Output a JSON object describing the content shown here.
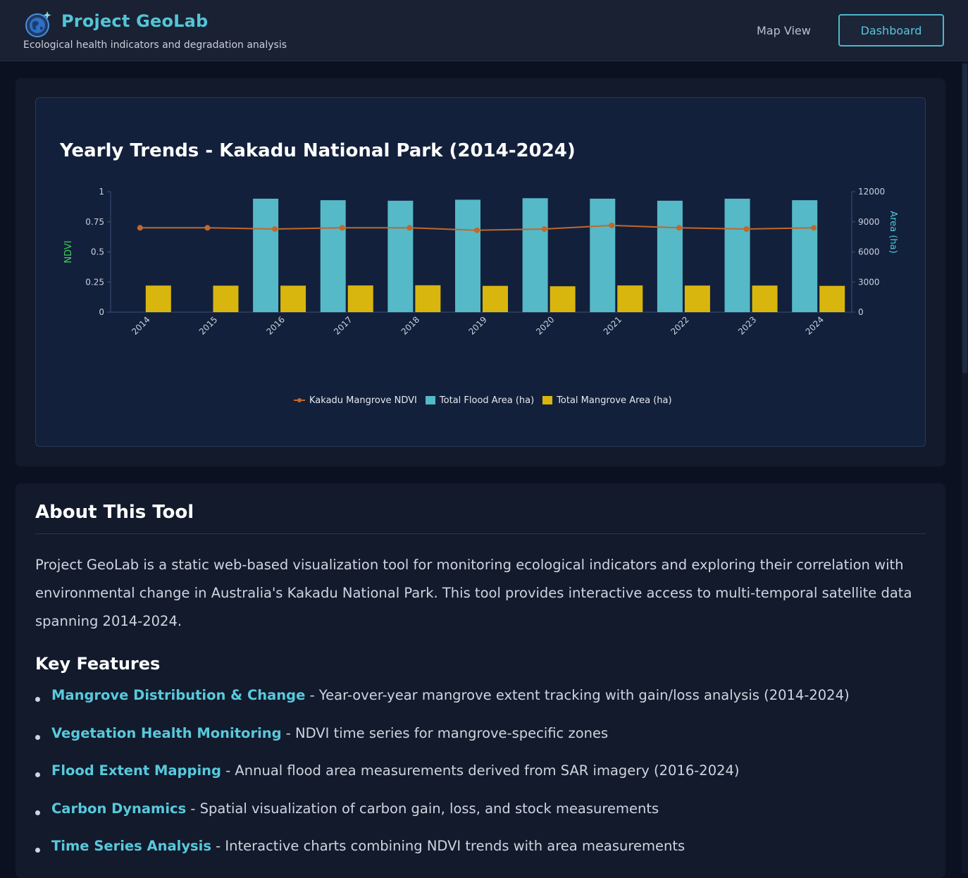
{
  "header": {
    "title": "Project GeoLab",
    "subtitle": "Ecological health indicators and degradation analysis",
    "nav_map_view": "Map View",
    "nav_dashboard": "Dashboard"
  },
  "colors": {
    "accent": "#52c5d8",
    "ndvi_line": "#c2672b",
    "flood_bar": "#55b9c7",
    "mangrove_bar": "#d8b60e"
  },
  "chart_title": "Yearly Trends - Kakadu National Park (2014-2024)",
  "legend": {
    "ndvi": "Kakadu Mangrove NDVI",
    "flood": "Total Flood Area (ha)",
    "mangrove": "Total Mangrove Area (ha)"
  },
  "chart_data": {
    "type": "bar",
    "title": "Yearly Trends - Kakadu National Park (2014-2024)",
    "categories": [
      "2014",
      "2015",
      "2016",
      "2017",
      "2018",
      "2019",
      "2020",
      "2021",
      "2022",
      "2023",
      "2024"
    ],
    "y_left": {
      "label": "NDVI",
      "range": [
        0,
        1
      ],
      "ticks": [
        "0",
        "0.25",
        "0.5",
        "0.75",
        "1"
      ]
    },
    "y_right": {
      "label": "Area (ha)",
      "range": [
        0,
        12000
      ],
      "ticks": [
        "0",
        "3000",
        "6000",
        "9000",
        "12000"
      ]
    },
    "series": [
      {
        "name": "Kakadu Mangrove NDVI",
        "kind": "line",
        "axis": "left",
        "values": [
          0.7,
          0.7,
          0.69,
          0.7,
          0.7,
          0.68,
          0.69,
          0.72,
          0.7,
          0.69,
          0.7
        ]
      },
      {
        "name": "Total Flood Area (ha)",
        "kind": "bar",
        "axis": "right",
        "values": [
          null,
          null,
          11300,
          11150,
          11100,
          11200,
          11350,
          11300,
          11100,
          11300,
          11150
        ]
      },
      {
        "name": "Total Mangrove Area (ha)",
        "kind": "bar",
        "axis": "right",
        "values": [
          2650,
          2640,
          2640,
          2660,
          2680,
          2620,
          2580,
          2660,
          2650,
          2650,
          2620
        ]
      }
    ],
    "legend_position": "bottom-center",
    "grid": false
  },
  "about": {
    "title": "About This Tool",
    "paragraph": "Project GeoLab is a static web-based visualization tool for monitoring ecological indicators and exploring their correlation with environmental change in Australia's Kakadu National Park. This tool provides interactive access to multi-temporal satellite data spanning 2014-2024.",
    "features_title": "Key Features",
    "features": [
      {
        "name": "Mangrove Distribution & Change",
        "desc": " - Year-over-year mangrove extent tracking with gain/loss analysis (2014-2024)"
      },
      {
        "name": "Vegetation Health Monitoring",
        "desc": " - NDVI time series for mangrove-specific zones"
      },
      {
        "name": "Flood Extent Mapping",
        "desc": " - Annual flood area measurements derived from SAR imagery (2016-2024)"
      },
      {
        "name": "Carbon Dynamics",
        "desc": " - Spatial visualization of carbon gain, loss, and stock measurements"
      },
      {
        "name": "Time Series Analysis",
        "desc": " - Interactive charts combining NDVI trends with area measurements"
      }
    ]
  }
}
